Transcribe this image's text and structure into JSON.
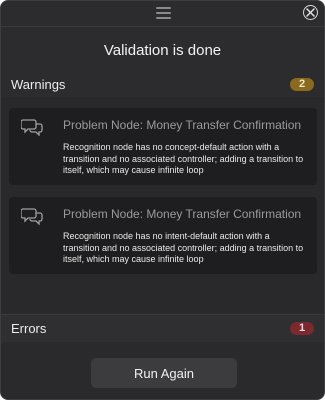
{
  "dialog": {
    "title": "Validation is done",
    "run_again_label": "Run Again"
  },
  "warnings": {
    "label": "Warnings",
    "count": "2",
    "badge_color": "#8a6a1f",
    "items": [
      {
        "title": "Problem Node: Money Transfer Confirmation",
        "body": "Recognition node has no concept-default action with a transition and no associated controller; adding a transition to itself, which may cause infinite loop",
        "icon": "chat-bubbles-icon"
      },
      {
        "title": "Problem Node: Money Transfer Confirmation",
        "body": "Recognition node has no intent-default action with a transition and no associated controller; adding a transition to itself, which may cause infinite loop",
        "icon": "chat-bubbles-icon"
      }
    ]
  },
  "errors": {
    "label": "Errors",
    "count": "1",
    "badge_color": "#7a2a2e"
  },
  "icons": {
    "drag_handle": "drag-handle-icon",
    "close": "close-icon"
  }
}
